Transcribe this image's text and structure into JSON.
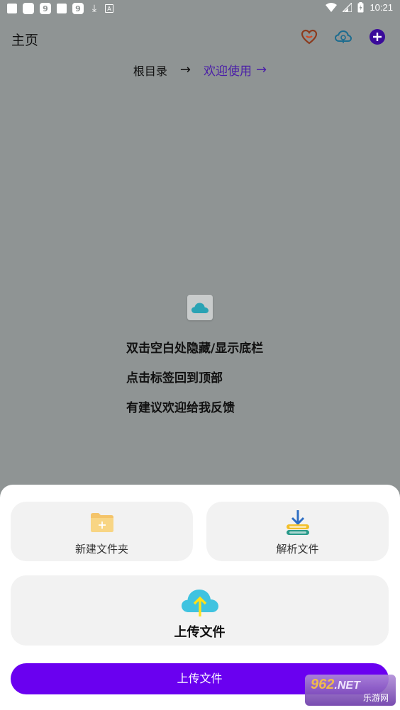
{
  "statusbar": {
    "time": "10:21",
    "notif_nine_1": "9",
    "notif_nine_2": "9",
    "notif_a": "A"
  },
  "header": {
    "title": "主页"
  },
  "breadcrumb": {
    "root": "根目录",
    "separator": "→",
    "current": "欢迎使用",
    "current_arrow": "→"
  },
  "tips": [
    "双击空白处隐藏/显示底栏",
    "点击标签回到顶部",
    "有建议欢迎给我反馈"
  ],
  "sheet": {
    "new_folder_label": "新建文件夹",
    "parse_file_label": "解析文件",
    "upload_card_label": "上传文件",
    "upload_button_label": "上传文件"
  },
  "watermark": {
    "top": "962",
    "net": ".NET",
    "bottom": "乐游网"
  },
  "colors": {
    "overlay_bg": "#8f9494",
    "accent": "#6a00f0",
    "breadcrumb_active": "#4b1fa8"
  }
}
